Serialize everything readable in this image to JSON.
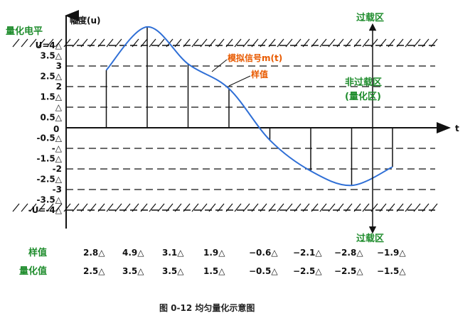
{
  "figure": {
    "caption": "图 0-12  均匀量化示意图",
    "y_axis_label": "幅度(u)",
    "x_axis_label": "t",
    "level_title": "量化电平",
    "signal_label": "模拟信号m(t)",
    "sample_label": "样值",
    "overload_top": "过载区",
    "overload_bottom": "过载区",
    "non_overload_line1": "非过载区",
    "non_overload_line2": "(量化区)",
    "zero_label": "0",
    "left_ticks": [
      "U=4△",
      "3.5△",
      "3",
      "2.5△",
      "2",
      "1.5△",
      "△",
      "0.5△",
      "-0.5△",
      "-△",
      "-1.5△",
      "-2",
      "-2.5△",
      "-3",
      "-3.5△",
      "-U=-4△"
    ],
    "sample_row_label": "样值",
    "sample_values": [
      "2.8△",
      "4.9△",
      "3.1△",
      "1.9△",
      "−0.6△",
      "−2.1△",
      "−2.8△",
      "−1.9△"
    ],
    "quant_row_label": "量化值",
    "quant_values": [
      "2.5△",
      "3.5△",
      "3.5△",
      "1.5△",
      "−0.5△",
      "−2.5△",
      "−2.5△",
      "−1.5△"
    ],
    "colors": {
      "signal": "#2f6fd6",
      "label_green": "#1e8c2c",
      "label_orange": "#e85a00"
    }
  },
  "chart_data": {
    "type": "line",
    "series": [
      {
        "values_t": [
          1,
          2,
          3,
          4,
          5,
          6,
          7,
          8
        ],
        "samples": [
          2.8,
          4.9,
          3.1,
          1.9,
          -0.6,
          -2.1,
          -2.8,
          -1.9
        ]
      }
    ],
    "quantized": [
      2.5,
      3.5,
      3.5,
      1.5,
      -0.5,
      -2.5,
      -2.5,
      -1.5
    ],
    "ylim": [
      -4,
      4
    ],
    "quant_step": "△",
    "dashed_levels": [
      3,
      2,
      1,
      -1,
      -2,
      -3
    ],
    "overload_levels": [
      4,
      -4
    ]
  }
}
